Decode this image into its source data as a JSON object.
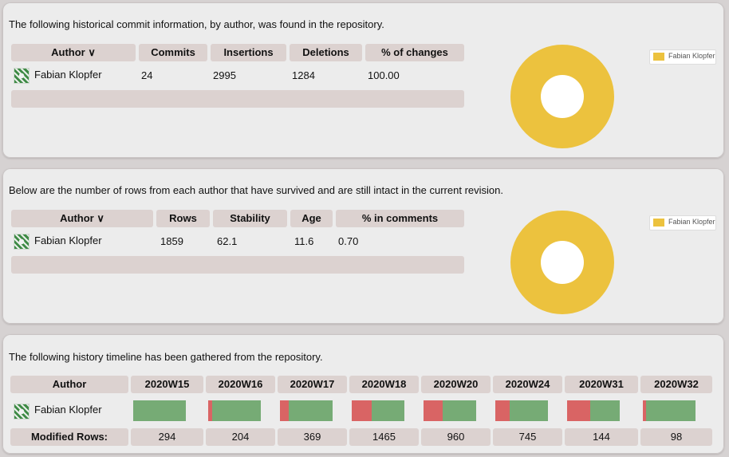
{
  "commits": {
    "intro": "The following historical commit information, by author, was found in the repository.",
    "headers": [
      "Author ∨",
      "Commits",
      "Insertions",
      "Deletions",
      "% of changes"
    ],
    "row": {
      "author": "Fabian Klopfer",
      "commits": "24",
      "insertions": "2995",
      "deletions": "1284",
      "percent": "100.00"
    },
    "legend": "Fabian Klopfer",
    "chart_color": "#ecc23e"
  },
  "survived": {
    "intro": "Below are the number of rows from each author that have survived and are still intact in the current revision.",
    "headers": [
      "Author ∨",
      "Rows",
      "Stability",
      "Age",
      "% in comments"
    ],
    "row": {
      "author": "Fabian Klopfer",
      "rows": "1859",
      "stability": "62.1",
      "age": "11.6",
      "comments": "0.70"
    },
    "legend": "Fabian Klopfer"
  },
  "timeline": {
    "intro": "The following history timeline has been gathered from the repository.",
    "author_header": "Author",
    "weeks": [
      "2020W15",
      "2020W16",
      "2020W17",
      "2020W18",
      "2020W20",
      "2020W24",
      "2020W31",
      "2020W32"
    ],
    "author": "Fabian Klopfer",
    "modified_label": "Modified Rows:",
    "modified": [
      "294",
      "204",
      "369",
      "1465",
      "960",
      "745",
      "144",
      "98"
    ],
    "removed_fraction": [
      0.0,
      0.07,
      0.17,
      0.38,
      0.36,
      0.28,
      0.44,
      0.06
    ],
    "colors": {
      "added": "#76ab75",
      "removed": "#d96464"
    }
  }
}
